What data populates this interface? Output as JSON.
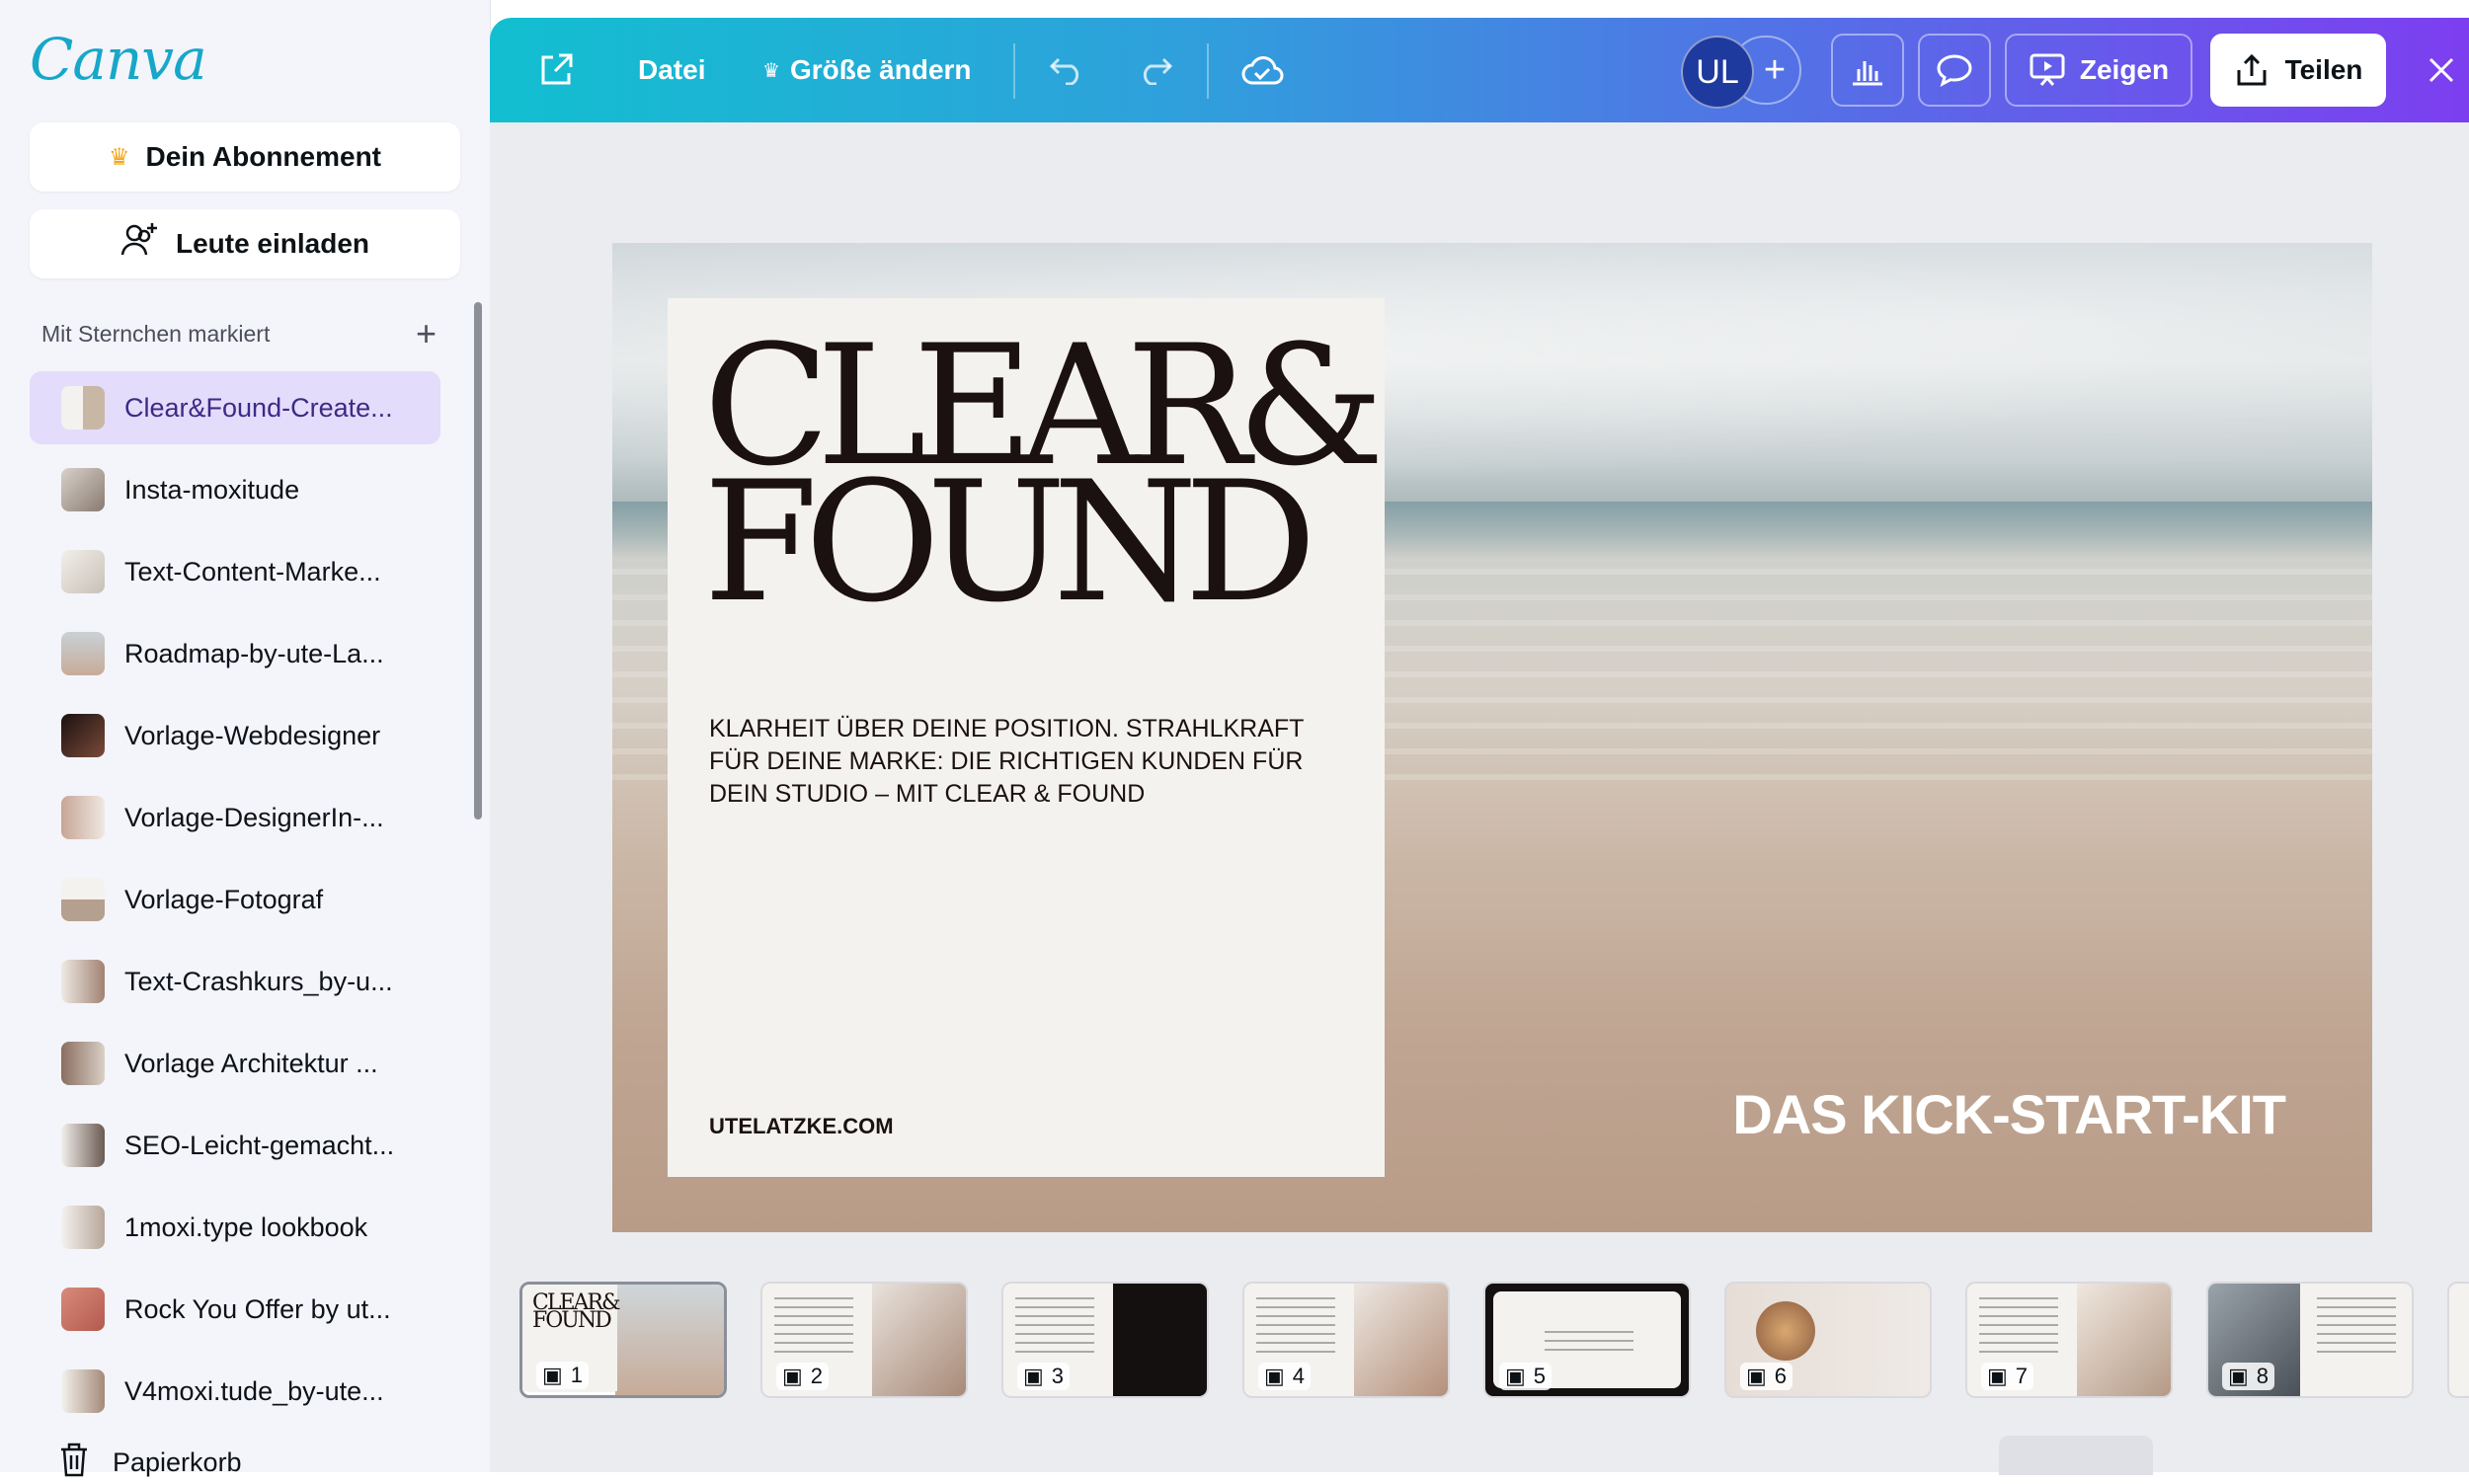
{
  "sidebar": {
    "logo": "Canva",
    "subscription_label": "Dein Abonnement",
    "invite_label": "Leute einladen",
    "starred_heading": "Mit Sternchen markiert",
    "items": [
      {
        "label": "Clear&Found-Create..."
      },
      {
        "label": "Insta-moxitude"
      },
      {
        "label": "Text-Content-Marke..."
      },
      {
        "label": "Roadmap-by-ute-La..."
      },
      {
        "label": "Vorlage-Webdesigner"
      },
      {
        "label": "Vorlage-DesignerIn-..."
      },
      {
        "label": "Vorlage-Fotograf"
      },
      {
        "label": "Text-Crashkurs_by-u..."
      },
      {
        "label": "Vorlage Architektur ..."
      },
      {
        "label": "SEO-Leicht-gemacht..."
      },
      {
        "label": "1moxi.type lookbook"
      },
      {
        "label": "Rock You Offer by ut..."
      },
      {
        "label": "V4moxi.tude_by-ute..."
      }
    ],
    "trash_label": "Papierkorb"
  },
  "toolbar": {
    "file_label": "Datei",
    "resize_label": "Größe ändern",
    "avatar_initials": "UL",
    "present_label": "Zeigen",
    "share_label": "Teilen"
  },
  "slide": {
    "title": "CLEAR&\nFOUND",
    "description": "KLARHEIT ÜBER DEINE POSITION. STRAHLKRAFT FÜR DEINE MARKE: DIE RICHTIGEN KUNDEN FÜR DEIN STUDIO – MIT CLEAR & FOUND",
    "url": "UTELATZKE.COM",
    "subtitle": "DAS KICK-START-KIT"
  },
  "thumbnails": [
    {
      "num": "1"
    },
    {
      "num": "2"
    },
    {
      "num": "3"
    },
    {
      "num": "4"
    },
    {
      "num": "5"
    },
    {
      "num": "6"
    },
    {
      "num": "7"
    },
    {
      "num": "8"
    }
  ],
  "colors": {
    "accent_teal": "#12bfd0",
    "accent_purple": "#7d3ef0",
    "active_item_bg": "#e4dcfb"
  }
}
